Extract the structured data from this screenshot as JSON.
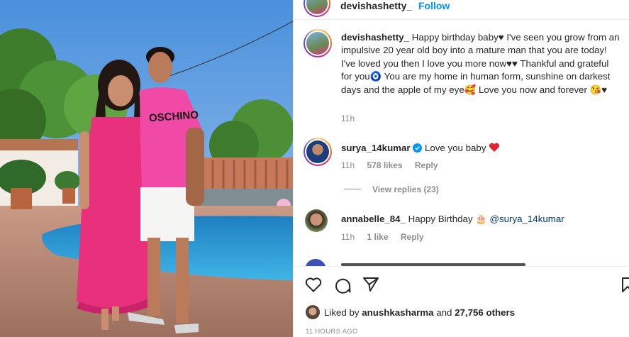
{
  "post": {
    "author": "devishashetty_",
    "follow_label": "Follow"
  },
  "caption": {
    "user": "devishashetty_",
    "text": "Happy birthday baby♥ I've seen you grow from an impulsive 20 year old boy into a mature man that you are today! I've loved you then I love you more now♥♥ Thankful and grateful for you🧿 You are my home in human form, sunshine on darkest days and the apple of my eye🥰 Love you now and forever 😘♥",
    "time": "11h"
  },
  "comments": [
    {
      "user": "surya_14kumar",
      "verified": true,
      "text": "Love you baby",
      "emoji": "heart-red-icon",
      "time": "11h",
      "likes": "578 likes",
      "reply": "Reply",
      "view_replies": "View replies (23)"
    },
    {
      "user": "annabelle_84_",
      "text": "Happy Birthday 🎂",
      "mention": "@surya_14kumar",
      "time": "11h",
      "likes": "1 like",
      "reply": "Reply"
    }
  ],
  "likes_line": {
    "prefix": "Liked by",
    "user": "anushkasharma",
    "mid": "and",
    "count": "27,756 others"
  },
  "timestamp": "11 HOURS AGO",
  "colors": {
    "link": "#0095f6",
    "muted": "#8e8e8e",
    "text": "#262626",
    "dress": "#e8307d",
    "shirt": "#f04aa6"
  }
}
